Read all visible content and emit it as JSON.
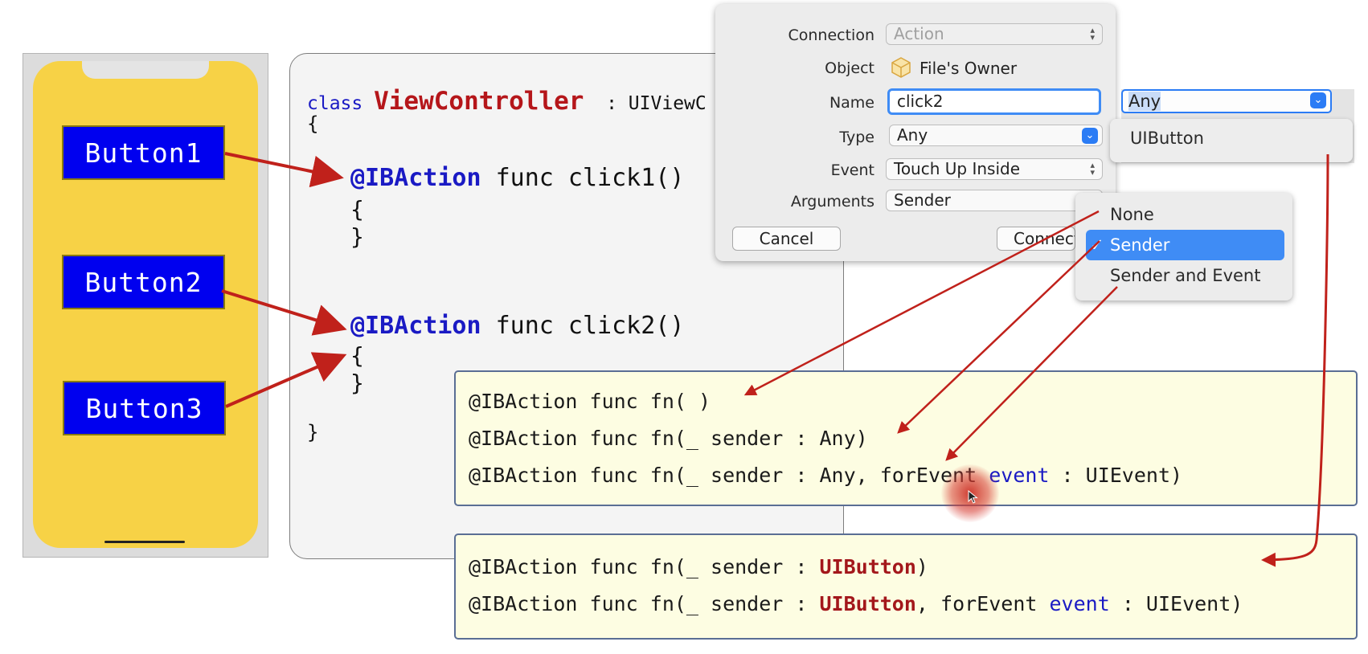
{
  "phone": {
    "buttons": [
      "Button1",
      "Button2",
      "Button3"
    ]
  },
  "code": {
    "class_kw": "class",
    "class_name": "ViewController",
    "class_rest": " : UIViewC",
    "open_brace": "{",
    "close_brace": "}",
    "action1_kw": "@IBAction",
    "action1_rest": " func click1()",
    "action2_kw": "@IBAction",
    "action2_rest": " func click2()"
  },
  "dialog": {
    "connection_label": "Connection",
    "connection_value": "Action",
    "object_label": "Object",
    "object_value": "File's Owner",
    "name_label": "Name",
    "name_value": "click2",
    "type_label": "Type",
    "type_value": "Any",
    "event_label": "Event",
    "event_value": "Touch Up Inside",
    "arguments_label": "Arguments",
    "arguments_value": "Sender",
    "cancel_label": "Cancel",
    "connect_label": "Connect"
  },
  "type_popup": {
    "selected": "Any",
    "option": "UIButton"
  },
  "arguments_menu": {
    "items": [
      "None",
      "Sender",
      "Sender and Event"
    ],
    "checked": "Sender",
    "check_glyph": "✓"
  },
  "signatures_any": {
    "line1": "@IBAction func fn( )",
    "line2": "@IBAction func fn(_ sender : Any)",
    "line3_a": "@IBAction func fn(_ sender : Any, forEvent ",
    "line3_event": "event",
    "line3_b": " : UIEvent)"
  },
  "signatures_uibutton": {
    "line1_a": "@IBAction func fn(_ sender : ",
    "line1_type": "UIButton",
    "line1_b": ")",
    "line2_a": "@IBAction func fn(_ sender : ",
    "line2_type": "UIButton",
    "line2_b": ", forEvent ",
    "line2_event": "event",
    "line2_c": " : UIEvent)"
  },
  "colors": {
    "phone_background": "#f7d246",
    "button_blue": "#0000ef",
    "arrow_red": "#c0211b",
    "highlight_blue": "#3f8cf5",
    "note_yellow": "#fdfde2"
  }
}
